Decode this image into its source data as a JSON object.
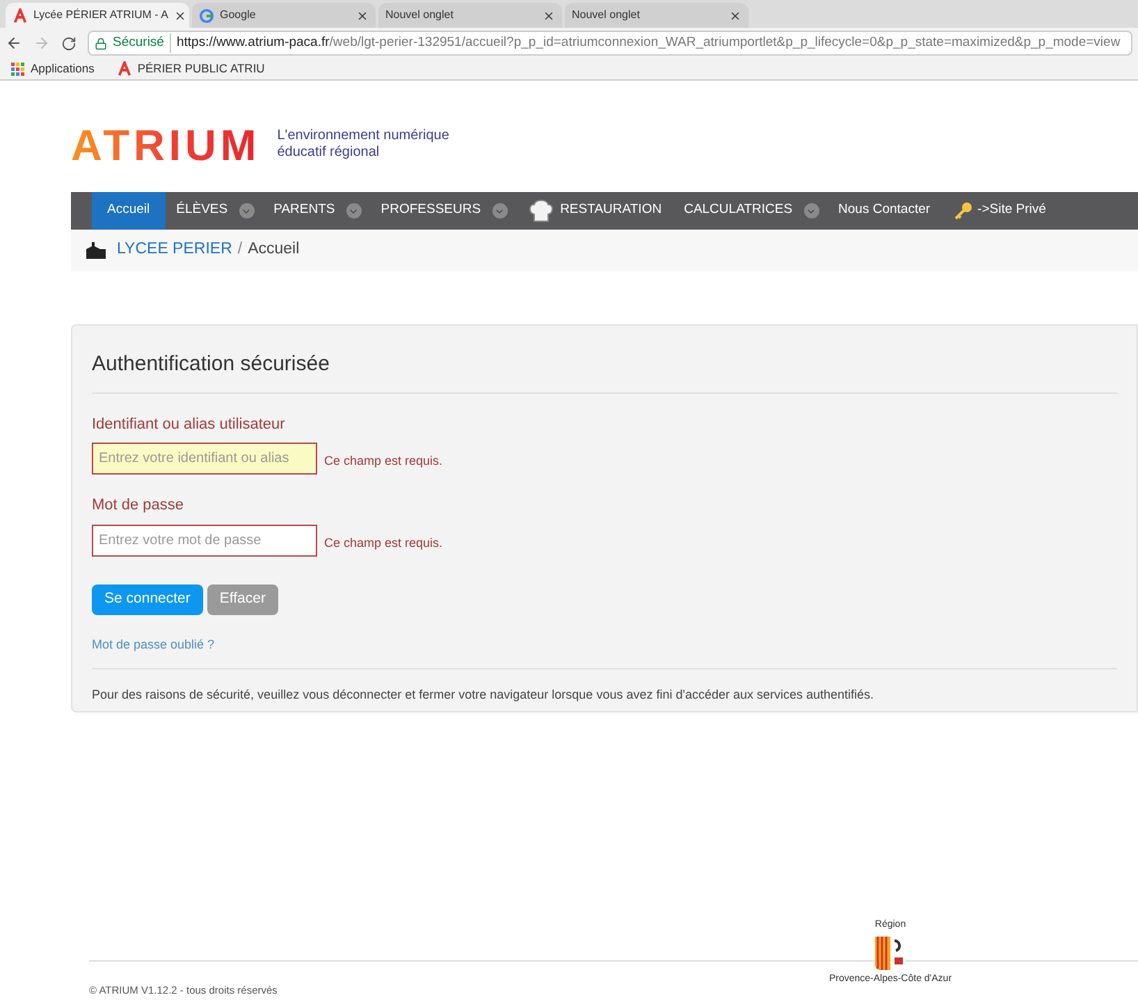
{
  "browser": {
    "tabs": [
      {
        "title": "Lycée PÉRIER ATRIUM - A",
        "kind": "atrium",
        "selected": true
      },
      {
        "title": "Google",
        "kind": "google",
        "selected": false
      },
      {
        "title": "Nouvel onglet",
        "kind": "blank",
        "selected": false
      },
      {
        "title": "Nouvel onglet",
        "kind": "blank",
        "selected": false
      }
    ],
    "address": {
      "secure_label": "Sécurisé",
      "url_host": "https://www.atrium-paca.fr",
      "url_rest": "/web/lgt-perier-132951/accueil?p_p_id=atriumconnexion_WAR_atriumportlet&p_p_lifecycle=0&p_p_state=maximized&p_p_mode=view"
    },
    "bookmarks": [
      {
        "label": "Applications",
        "kind": "apps"
      },
      {
        "label": "PÉRIER PUBLIC ATRIU",
        "kind": "atrium"
      }
    ]
  },
  "site": {
    "logo": "ATRIUM",
    "tagline": [
      "L'environnement numérique",
      "éducatif régional"
    ],
    "nav": [
      {
        "label": "Accueil",
        "selected": true,
        "dropdown": false,
        "kind": "text"
      },
      {
        "label": "ÉLÈVES",
        "selected": false,
        "dropdown": true,
        "kind": "text"
      },
      {
        "label": "PARENTS",
        "selected": false,
        "dropdown": true,
        "kind": "text"
      },
      {
        "label": "PROFESSEURS",
        "selected": false,
        "dropdown": true,
        "kind": "text"
      },
      {
        "label": "RESTAURATION",
        "selected": false,
        "dropdown": false,
        "kind": "chef"
      },
      {
        "label": "CALCULATRICES",
        "selected": false,
        "dropdown": true,
        "kind": "text"
      },
      {
        "label": "Nous Contacter",
        "selected": false,
        "dropdown": false,
        "kind": "text"
      },
      {
        "label": "->Site Privé",
        "selected": false,
        "dropdown": false,
        "kind": "key"
      }
    ],
    "breadcrumb": {
      "school": "LYCEE PERIER",
      "separator": "/",
      "current": "Accueil"
    }
  },
  "login": {
    "title": "Authentification sécurisée",
    "fields": [
      {
        "label": "Identifiant ou alias utilisateur",
        "placeholder": "Entrez votre identifiant ou alias",
        "error": "Ce champ est requis.",
        "focused": true
      },
      {
        "label": "Mot de passe",
        "placeholder": "Entrez votre mot de passe",
        "error": "Ce champ est requis.",
        "focused": false
      }
    ],
    "buttons": [
      {
        "label": "Se connecter",
        "kind": "primary"
      },
      {
        "label": "Effacer",
        "kind": "secondary"
      }
    ],
    "forgot_link": "Mot de passe oublié ?",
    "notice": "Pour des raisons de sécurité, veuillez vous déconnecter et fermer votre navigateur lorsque vous avez fini d'accéder aux services authentifiés."
  },
  "footer": {
    "copyright": "© ATRIUM V1.12.2 - tous droits réservés",
    "region_top": "Région",
    "region_bottom": "Provence-Alpes-Côte d'Azur"
  }
}
